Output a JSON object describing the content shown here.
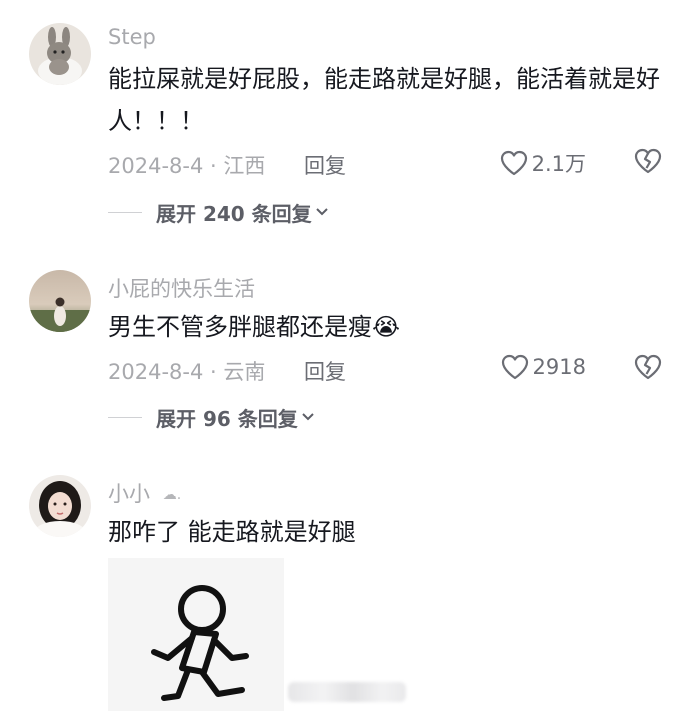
{
  "comments": [
    {
      "username": "Step",
      "text": "能拉屎就是好屁股，能走路就是好腿，能活着就是好人！！！",
      "date_location": "2024-8-4 · 江西",
      "reply_label": "回复",
      "likes": "2.1万",
      "more_replies": "展开 240 条回复"
    },
    {
      "username": "小屁的快乐生活",
      "text": "男生不管多胖腿都还是瘦😭",
      "date_location": "2024-8-4 · 云南",
      "reply_label": "回复",
      "likes": "2918",
      "more_replies": "展开 96 条回复"
    },
    {
      "username": "小小",
      "username_badge": "☁.",
      "text": "那咋了 能走路就是好腿"
    }
  ],
  "icons": {
    "like": "heart-outline-icon",
    "dislike": "broken-heart-icon",
    "expand": "chevron-down-icon"
  },
  "colors": {
    "meta_text": "#a8a9ad",
    "body_text": "#16181f",
    "sticker_bg": "#f5f5f5"
  }
}
